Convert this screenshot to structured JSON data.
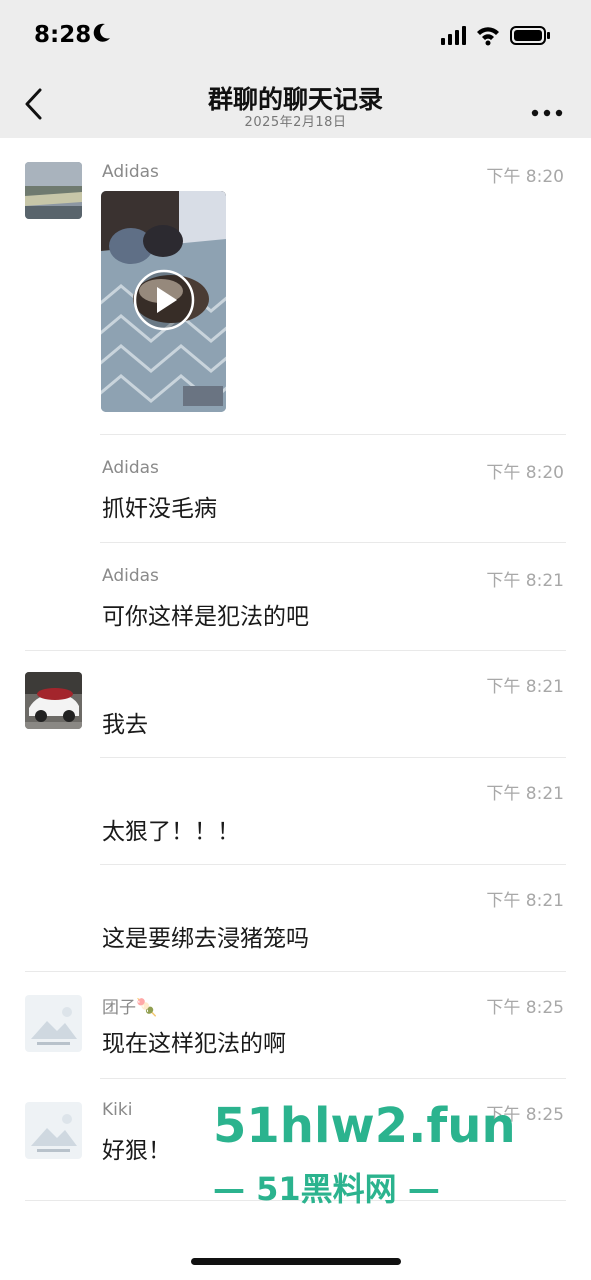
{
  "status_bar": {
    "time": "8:28",
    "moon_icon": "moon-icon",
    "signal_icon": "cellular-signal-icon",
    "wifi_icon": "wifi-icon",
    "battery_icon": "battery-icon"
  },
  "nav": {
    "title": "群聊的聊天记录",
    "subtitle": "2025年2月18日",
    "back_icon": "chevron-left-icon",
    "more_icon": "more-dots-icon"
  },
  "messages": [
    {
      "sender": "Adidas",
      "time": "下午 8:20",
      "type": "video"
    },
    {
      "sender": "Adidas",
      "time": "下午 8:20",
      "text": "抓奸没毛病"
    },
    {
      "sender": "Adidas",
      "time": "下午 8:21",
      "text": "可你这样是犯法的吧"
    },
    {
      "sender": "",
      "time": "下午 8:21",
      "text": "我去"
    },
    {
      "sender": "",
      "time": "下午 8:21",
      "text": "太狠了！！！"
    },
    {
      "sender": "",
      "time": "下午 8:21",
      "text": "这是要绑去浸猪笼吗"
    },
    {
      "sender": "团子🍡",
      "time": "下午 8:25",
      "text": "现在这样犯法的啊"
    },
    {
      "sender": "Kiki",
      "time": "下午 8:25",
      "text": "好狠！"
    }
  ],
  "watermark": {
    "main": "51hlw2.fun",
    "sub": "— 51黑料网 —"
  },
  "colors": {
    "header_bg": "#ededed",
    "watermark": "#2bb38e"
  }
}
